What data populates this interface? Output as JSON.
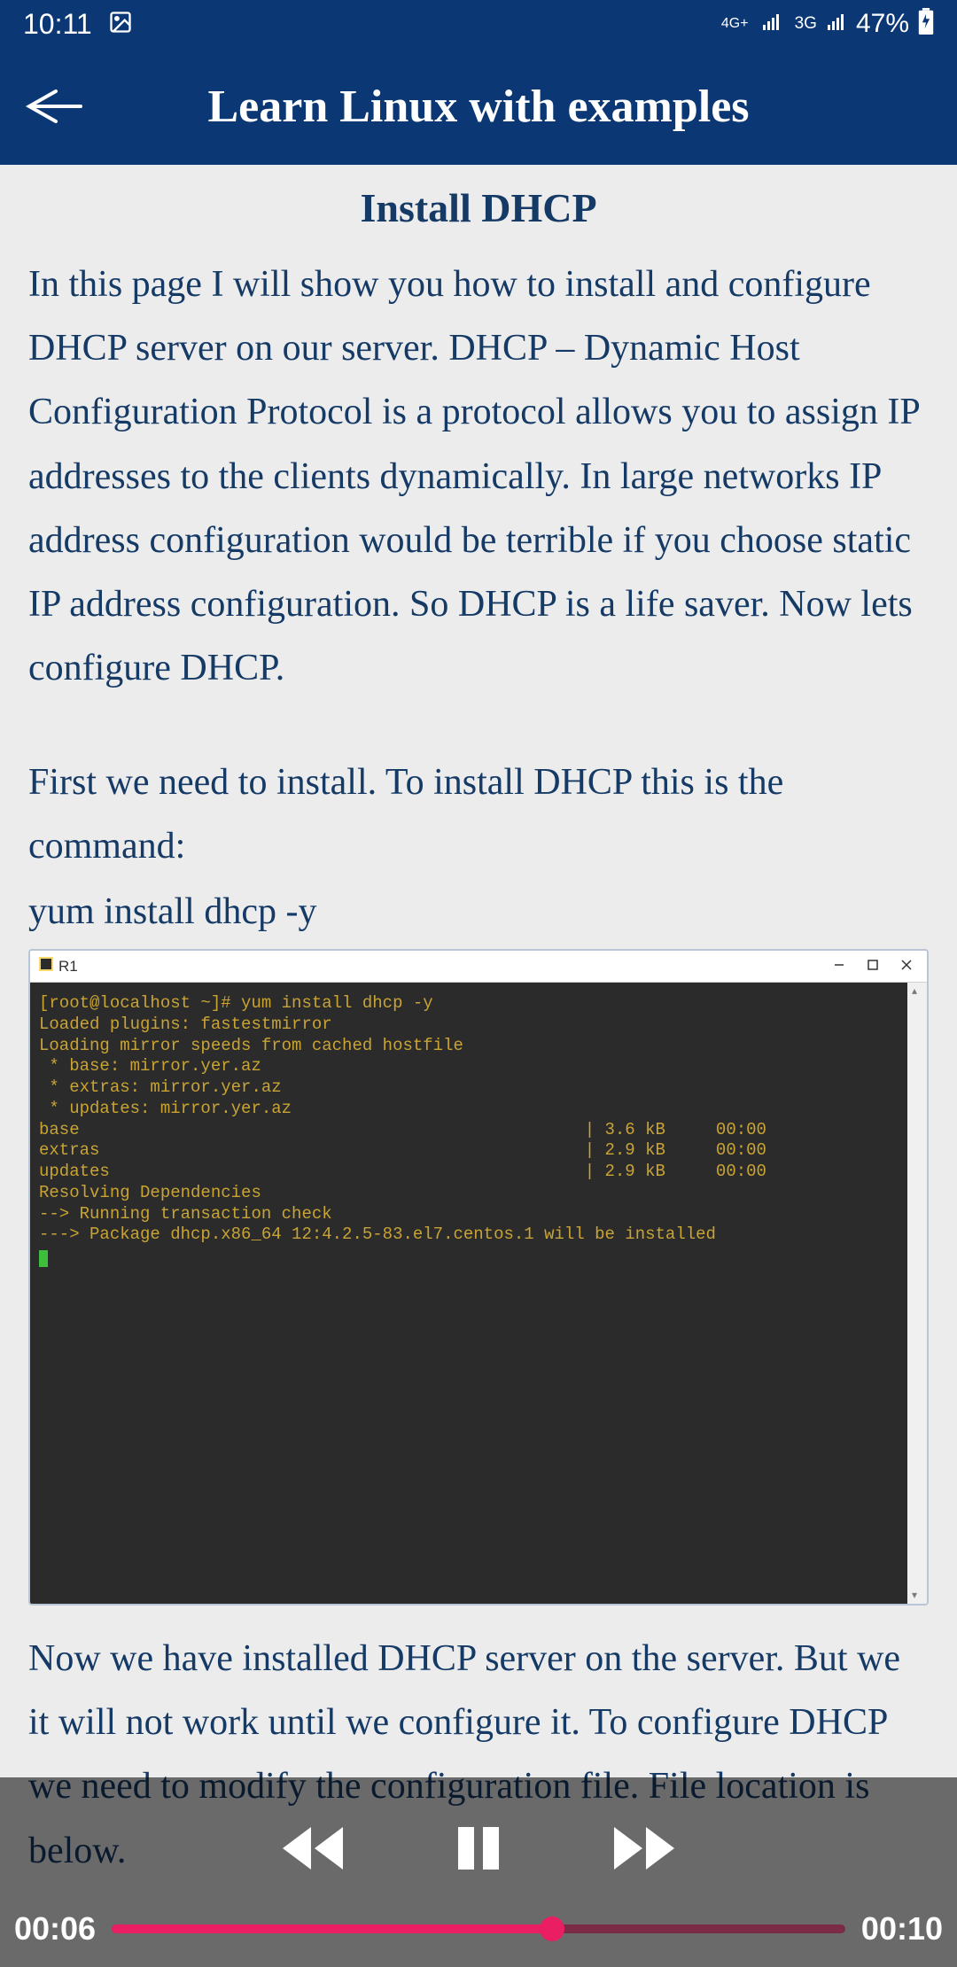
{
  "status": {
    "time": "10:11",
    "net1": "4G+",
    "net2": "3G",
    "battery_pct": "47%"
  },
  "appbar": {
    "title": "Learn Linux with examples"
  },
  "article": {
    "title": "Install DHCP",
    "p1": "In this page I will show you how to install and configure DHCP server on our server. DHCP – Dynamic Host Configuration Protocol is a protocol allows you to assign IP addresses to the clients dynamically. In large networks IP address configuration would be terrible if you choose static IP address configuration. So DHCP is a life saver. Now lets configure DHCP.",
    "p2": " First we need to install. To install DHCP this is the command:",
    "cmd": " yum install dhcp -y",
    "p3": "Now we have installed DHCP server on the server. But we it will not work until we configure it. To configure DHCP we need to modify the configuration file. File location is below."
  },
  "terminal": {
    "window_title": "R1",
    "lines": [
      "[root@localhost ~]# yum install dhcp -y",
      "Loaded plugins: fastestmirror",
      "Loading mirror speeds from cached hostfile",
      " * base: mirror.yer.az",
      " * extras: mirror.yer.az",
      " * updates: mirror.yer.az",
      "base                                                  | 3.6 kB     00:00",
      "extras                                                | 2.9 kB     00:00",
      "updates                                               | 2.9 kB     00:00",
      "Resolving Dependencies",
      "--> Running transaction check",
      "---> Package dhcp.x86_64 12:4.2.5-83.el7.centos.1 will be installed"
    ]
  },
  "player": {
    "t_current": "00:06",
    "t_total": "00:10"
  }
}
